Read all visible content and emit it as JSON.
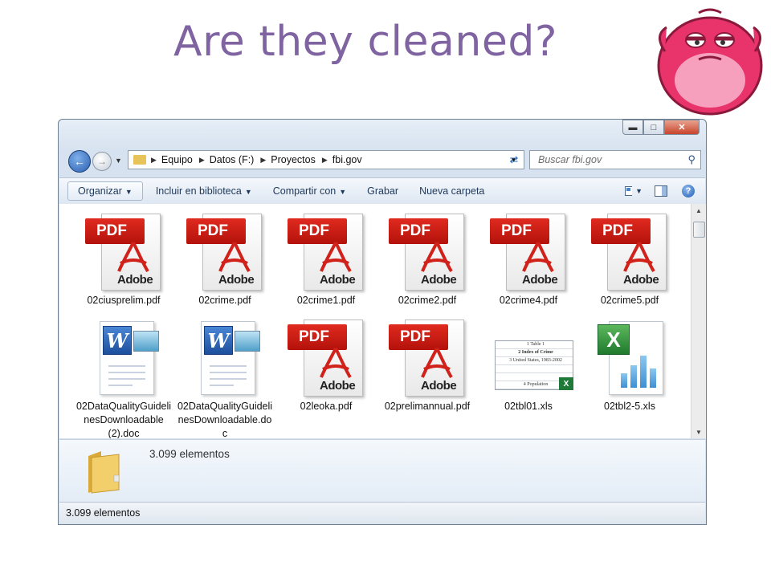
{
  "slide": {
    "title": "Are they cleaned?"
  },
  "window": {
    "breadcrumb": [
      "Equipo",
      "Datos (F:)",
      "Proyectos",
      "fbi.gov"
    ],
    "search_placeholder": "Buscar fbi.gov",
    "toolbar": {
      "organize": "Organizar",
      "include_library": "Incluir en biblioteca",
      "share_with": "Compartir con",
      "burn": "Grabar",
      "new_folder": "Nueva carpeta"
    },
    "files": [
      {
        "name": "02ciusprelim.pdf",
        "type": "pdf"
      },
      {
        "name": "02crime.pdf",
        "type": "pdf"
      },
      {
        "name": "02crime1.pdf",
        "type": "pdf"
      },
      {
        "name": "02crime2.pdf",
        "type": "pdf"
      },
      {
        "name": "02crime4.pdf",
        "type": "pdf"
      },
      {
        "name": "02crime5.pdf",
        "type": "pdf"
      },
      {
        "name": "02DataQualityGuidelinesDownloadable (2).doc",
        "type": "doc"
      },
      {
        "name": "02DataQualityGuidelinesDownloadable.doc",
        "type": "doc"
      },
      {
        "name": "02leoka.pdf",
        "type": "pdf"
      },
      {
        "name": "02prelimannual.pdf",
        "type": "pdf"
      },
      {
        "name": "02tbl01.xls",
        "type": "xls-preview"
      },
      {
        "name": "02tbl2-5.xls",
        "type": "xls"
      }
    ],
    "icon_text": {
      "pdf_band": "PDF",
      "pdf_brand": "Adobe",
      "word_letter": "W",
      "excel_letter": "X",
      "xls_preview_rows": [
        "1  Table 1",
        "2  Index of Crime",
        "3  United States, 1983-2002",
        "",
        "",
        "4  Population"
      ]
    },
    "details_count": "3.099 elementos",
    "status_count": "3.099 elementos"
  },
  "colors": {
    "title": "#8064A2",
    "pdf_red": "#D0211A",
    "window_frame": "#D6E2EF"
  }
}
